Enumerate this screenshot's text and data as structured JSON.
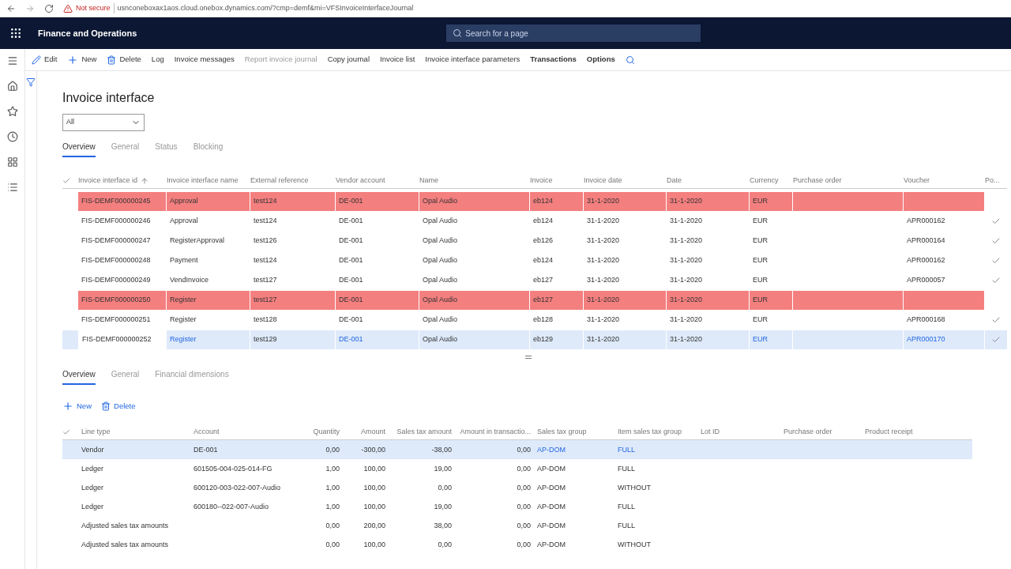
{
  "browser": {
    "security": "Not secure",
    "url": "usnconeboxax1aos.cloud.onebox.dynamics.com/?cmp=demf&mi=VFSInvoiceInterfaceJournal"
  },
  "app": {
    "title": "Finance and Operations",
    "search_placeholder": "Search for a page"
  },
  "actions": [
    {
      "label": "Edit",
      "kind": "edit",
      "disabled": false,
      "bold": false
    },
    {
      "label": "New",
      "kind": "new",
      "disabled": false,
      "bold": false
    },
    {
      "label": "Delete",
      "kind": "delete",
      "disabled": false,
      "bold": false
    },
    {
      "label": "Log",
      "kind": "plain",
      "disabled": false,
      "bold": false
    },
    {
      "label": "Invoice messages",
      "kind": "plain",
      "disabled": false,
      "bold": false
    },
    {
      "label": "Report invoice journal",
      "kind": "plain",
      "disabled": true,
      "bold": false
    },
    {
      "label": "Copy journal",
      "kind": "plain",
      "disabled": false,
      "bold": false
    },
    {
      "label": "Invoice list",
      "kind": "plain",
      "disabled": false,
      "bold": false
    },
    {
      "label": "Invoice interface parameters",
      "kind": "plain",
      "disabled": false,
      "bold": false
    },
    {
      "label": "Transactions",
      "kind": "plain",
      "disabled": false,
      "bold": true
    },
    {
      "label": "Options",
      "kind": "plain",
      "disabled": false,
      "bold": true
    }
  ],
  "page_title": "Invoice interface",
  "filter": {
    "value": "All"
  },
  "tabs": [
    {
      "label": "Overview",
      "selected": true
    },
    {
      "label": "General",
      "selected": false
    },
    {
      "label": "Status",
      "selected": false
    },
    {
      "label": "Blocking",
      "selected": false
    }
  ],
  "journal": {
    "columns": [
      "Invoice interface id",
      "Invoice interface name",
      "External reference",
      "Vendor account",
      "Name",
      "Invoice",
      "Invoice date",
      "Date",
      "Currency",
      "Purchase order",
      "Voucher",
      "Po..."
    ],
    "rows": [
      {
        "cells": [
          "FIS-DEMF000000245",
          "Approval",
          "test124",
          "DE-001",
          "Opal Audio",
          "eb124",
          "31-1-2020",
          "31-1-2020",
          "EUR",
          "",
          ""
        ],
        "error": true,
        "selected": false,
        "posted": false
      },
      {
        "cells": [
          "FIS-DEMF000000246",
          "Approval",
          "test124",
          "DE-001",
          "Opal Audio",
          "eb124",
          "31-1-2020",
          "31-1-2020",
          "EUR",
          "",
          "APR000162"
        ],
        "error": false,
        "selected": false,
        "posted": true
      },
      {
        "cells": [
          "FIS-DEMF000000247",
          "RegisterApproval",
          "test126",
          "DE-001",
          "Opal Audio",
          "eb126",
          "31-1-2020",
          "31-1-2020",
          "EUR",
          "",
          "APR000164"
        ],
        "error": false,
        "selected": false,
        "posted": true
      },
      {
        "cells": [
          "FIS-DEMF000000248",
          "Payment",
          "test124",
          "DE-001",
          "Opal Audio",
          "eb124",
          "31-1-2020",
          "31-1-2020",
          "EUR",
          "",
          "APR000162"
        ],
        "error": false,
        "selected": false,
        "posted": true
      },
      {
        "cells": [
          "FIS-DEMF000000249",
          "VendInvoice",
          "test127",
          "DE-001",
          "Opal Audio",
          "eb127",
          "31-1-2020",
          "31-1-2020",
          "EUR",
          "",
          "APR000057"
        ],
        "error": false,
        "selected": false,
        "posted": true
      },
      {
        "cells": [
          "FIS-DEMF000000250",
          "Register",
          "test127",
          "DE-001",
          "Opal Audio",
          "eb127",
          "31-1-2020",
          "31-1-2020",
          "EUR",
          "",
          ""
        ],
        "error": true,
        "selected": false,
        "posted": false
      },
      {
        "cells": [
          "FIS-DEMF000000251",
          "Register",
          "test128",
          "DE-001",
          "Opal Audio",
          "eb128",
          "31-1-2020",
          "31-1-2020",
          "EUR",
          "",
          "APR000168"
        ],
        "error": false,
        "selected": false,
        "posted": true
      },
      {
        "cells": [
          "FIS-DEMF000000252",
          "Register",
          "test129",
          "DE-001",
          "Opal Audio",
          "eb129",
          "31-1-2020",
          "31-1-2020",
          "EUR",
          "",
          "APR000170"
        ],
        "error": false,
        "selected": true,
        "posted": true
      }
    ]
  },
  "line_tabs": [
    {
      "label": "Overview",
      "selected": true
    },
    {
      "label": "General",
      "selected": false
    },
    {
      "label": "Financial dimensions",
      "selected": false
    }
  ],
  "line_actions": [
    {
      "label": "New",
      "kind": "new"
    },
    {
      "label": "Delete",
      "kind": "delete"
    }
  ],
  "lines": {
    "columns": [
      "Line type",
      "Account",
      "Quantity",
      "Amount",
      "Sales tax amount",
      "Amount in transactio...",
      "Sales tax group",
      "Item sales tax group",
      "Lot ID",
      "Purchase order",
      "Product receipt"
    ],
    "rows": [
      {
        "cells": [
          "Vendor",
          "DE-001",
          "0,00",
          "-300,00",
          "-38,00",
          "0,00",
          "AP-DOM",
          "FULL",
          "",
          "",
          ""
        ],
        "selected": true
      },
      {
        "cells": [
          "Ledger",
          "601505-004-025-014-FG",
          "1,00",
          "100,00",
          "19,00",
          "0,00",
          "AP-DOM",
          "FULL",
          "",
          "",
          ""
        ],
        "selected": false
      },
      {
        "cells": [
          "Ledger",
          "600120-003-022-007-Audio",
          "1,00",
          "100,00",
          "0,00",
          "0,00",
          "AP-DOM",
          "WITHOUT",
          "",
          "",
          ""
        ],
        "selected": false
      },
      {
        "cells": [
          "Ledger",
          "600180--022-007-Audio",
          "1,00",
          "100,00",
          "19,00",
          "0,00",
          "AP-DOM",
          "FULL",
          "",
          "",
          ""
        ],
        "selected": false
      },
      {
        "cells": [
          "Adjusted sales tax amounts",
          "",
          "0,00",
          "200,00",
          "38,00",
          "0,00",
          "AP-DOM",
          "FULL",
          "",
          "",
          ""
        ],
        "selected": false
      },
      {
        "cells": [
          "Adjusted sales tax amounts",
          "",
          "0,00",
          "100,00",
          "0,00",
          "0,00",
          "AP-DOM",
          "WITHOUT",
          "",
          "",
          ""
        ],
        "selected": false
      }
    ]
  }
}
